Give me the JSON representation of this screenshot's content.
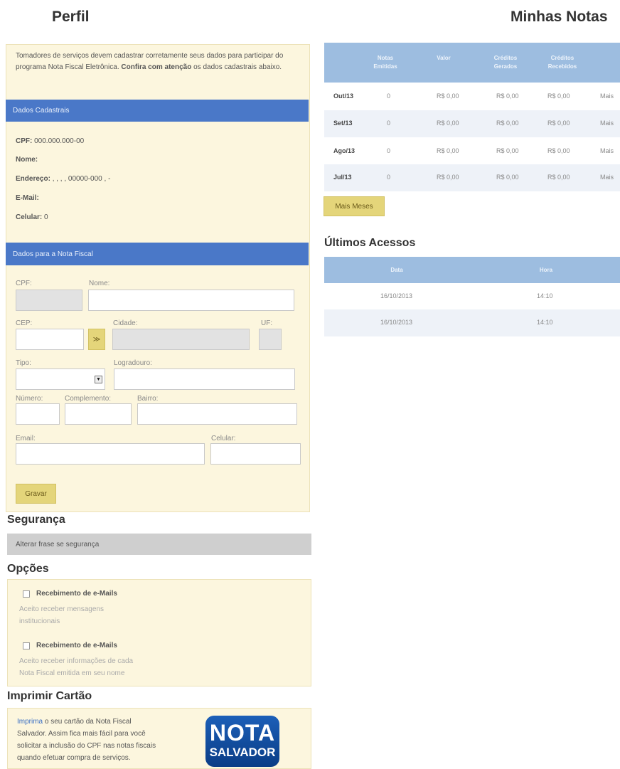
{
  "headings": {
    "profile": "Perfil",
    "notes": "Minhas Notas",
    "last_access": "Últimos Acessos",
    "security": "Segurança",
    "options": "Opções",
    "print_card": "Imprimir Cartão"
  },
  "intro": {
    "text": "Tomadores de serviços devem cadastrar corretamente seus dados para participar do programa Nota Fiscal Eletrônica.",
    "strong": "Confira com atenção",
    "end": "os dados cadastrais abaixo."
  },
  "registration": {
    "title": "Dados Cadastrais",
    "cpf_label": "CPF:",
    "cpf_value": "000.000.000-00",
    "name_label": "Nome:",
    "address_label": "Endereço:",
    "address_value": ", , , , 00000-000 , -",
    "email_label": "E-Mail:",
    "mobile_label": "Celular:",
    "mobile_value": "0"
  },
  "invoice_form": {
    "title": "Dados para a Nota Fiscal",
    "cpf": "CPF:",
    "name": "Nome:",
    "cep": "CEP:",
    "city": "Cidade:",
    "uf": "UF:",
    "type": "Tipo:",
    "street": "Logradouro:",
    "number": "Número:",
    "complement": "Complemento:",
    "district": "Bairro:",
    "email": "Email:",
    "mobile": "Celular:",
    "search_btn": "≫",
    "save_btn": "Gravar"
  },
  "notes_table": {
    "headers": [
      "Notas Emitidas",
      "Valor",
      "Créditos Gerados",
      "Créditos Recebidos"
    ],
    "rows": [
      {
        "month": "Out/13",
        "issued": "0",
        "value": "R$ 0,00",
        "generated": "R$ 0,00",
        "received": "R$ 0,00",
        "more": "Mais"
      },
      {
        "month": "Set/13",
        "issued": "0",
        "value": "R$ 0,00",
        "generated": "R$ 0,00",
        "received": "R$ 0,00",
        "more": "Mais"
      },
      {
        "month": "Ago/13",
        "issued": "0",
        "value": "R$ 0,00",
        "generated": "R$ 0,00",
        "received": "R$ 0,00",
        "more": "Mais"
      },
      {
        "month": "Jul/13",
        "issued": "0",
        "value": "R$ 0,00",
        "generated": "R$ 0,00",
        "received": "R$ 0,00",
        "more": "Mais"
      }
    ],
    "more_months": "Mais Meses"
  },
  "access_table": {
    "headers": [
      "Data",
      "Hora"
    ],
    "rows": [
      {
        "date": "16/10/2013",
        "time": "14:10"
      },
      {
        "date": "16/10/2013",
        "time": "14:10"
      }
    ]
  },
  "security": {
    "change_phrase": "Alterar frase se segurança"
  },
  "options": [
    {
      "title": "Recebimento de e-Mails",
      "desc1": "Aceito receber mensagens",
      "desc2": "institucionais"
    },
    {
      "title": "Recebimento de e-Mails",
      "desc1": "Aceito receber informações de cada",
      "desc2": "Nota Fiscal emitida em seu nome"
    }
  ],
  "print": {
    "link": "Imprima",
    "l1": "o seu cartão da Nota Fiscal",
    "l2": "Salvador. Assim fica mais fácil para você",
    "l3": "solicitar a inclusão do CPF nas notas fiscais",
    "l4": "quando efetuar compra de serviços.",
    "logo_top": "NOTA",
    "logo_bottom": "SALVADOR"
  },
  "colors": {
    "panel": "#fcf6de",
    "blue_bar": "#4a78c8",
    "table_head": "#9dbde0",
    "button": "#e4d57a",
    "link": "#3a6fc4"
  },
  "icons": [
    "dropdown-arrow-icon",
    "checkbox-icon",
    "nota-salvador-logo"
  ]
}
